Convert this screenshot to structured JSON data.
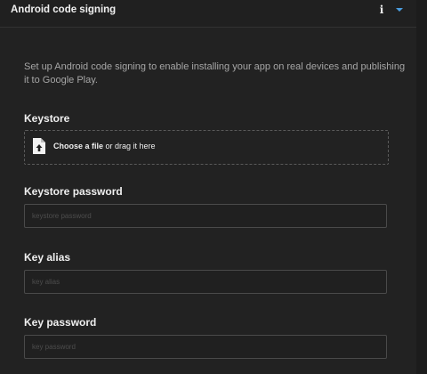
{
  "header": {
    "title": "Android code signing",
    "info_icon": "info-icon",
    "chevron_icon": "chevron-down-icon",
    "chevron_color": "#4a9de0"
  },
  "intro": "Set up Android code signing to enable installing your app on real devices and publishing it to Google Play.",
  "keystore": {
    "label": "Keystore",
    "upload_action": "Choose a file",
    "upload_hint": " or drag it here",
    "icon": "file-upload-icon"
  },
  "keystore_password": {
    "label": "Keystore password",
    "placeholder": "keystore password",
    "value": ""
  },
  "key_alias": {
    "label": "Key alias",
    "placeholder": "key alias",
    "value": ""
  },
  "key_password": {
    "label": "Key password",
    "placeholder": "key password",
    "value": ""
  }
}
